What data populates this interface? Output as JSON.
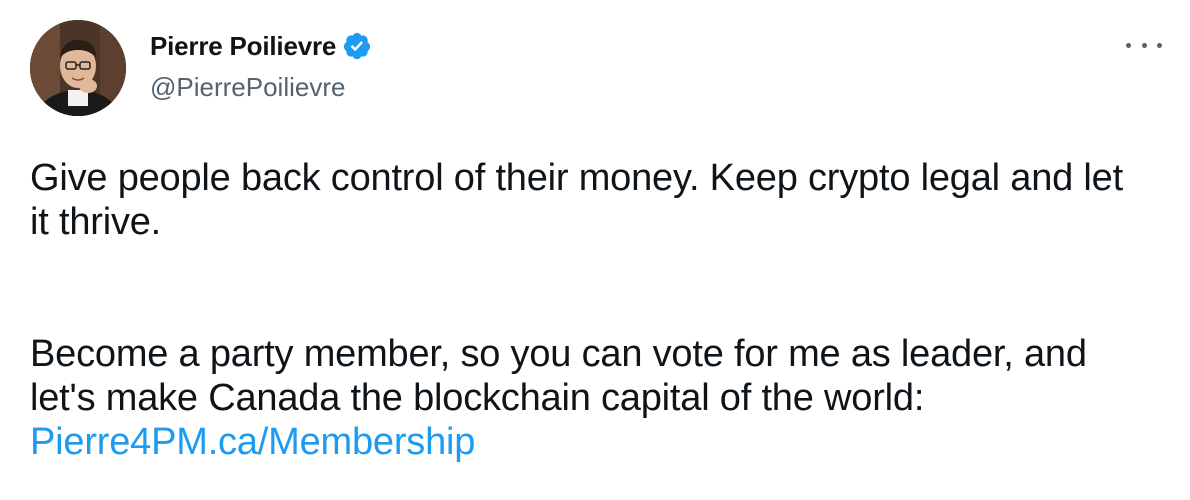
{
  "author": {
    "display_name": "Pierre Poilievre",
    "handle": "@PierrePoilievre",
    "verified_icon": "verified-badge-icon",
    "avatar_icon": "avatar-photo"
  },
  "tweet": {
    "paragraph_1": "Give people back control of their money. Keep crypto legal and let it thrive.",
    "paragraph_2_text": "Become a party member, so you can vote for me as leader, and let's make Canada the blockchain capital of the world: ",
    "link_text": "Pierre4PM.ca/Membership"
  },
  "menu": {
    "more_icon": "more-options-icon"
  },
  "colors": {
    "text": "#0f1419",
    "secondary": "#536471",
    "link": "#1d9bf0",
    "verified": "#1d9bf0"
  }
}
